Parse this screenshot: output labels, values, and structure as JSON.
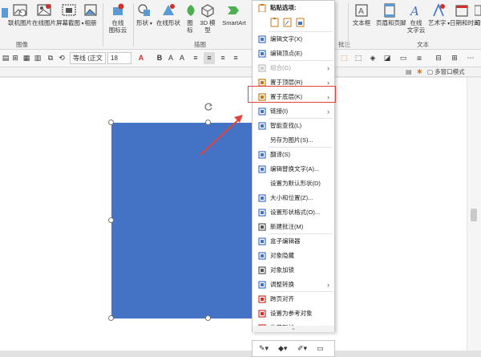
{
  "ribbon": {
    "buttons": [
      {
        "label": "联机图片",
        "icon": "online-picture-icon"
      },
      {
        "label": "在线图片",
        "icon": "picture-icon"
      },
      {
        "label": "屏幕截图",
        "icon": "screenshot-icon"
      },
      {
        "label": "相册",
        "icon": "album-icon"
      },
      {
        "label": "在线",
        "label2": "图标云",
        "icon": "icon-cloud-icon"
      },
      {
        "label": "形状",
        "icon": "shapes-icon"
      },
      {
        "label": "在线形状",
        "icon": "online-shapes-icon"
      },
      {
        "label": "图",
        "label2": "标",
        "icon": "icons-icon"
      },
      {
        "label": "3D 模",
        "label2": "型",
        "icon": "3d-model-icon"
      },
      {
        "label": "SmartArt",
        "icon": "smartart-icon"
      },
      {
        "label": "文本框",
        "icon": "textbox-icon"
      },
      {
        "label": "页眉和页脚",
        "icon": "header-footer-icon"
      },
      {
        "label": "艺术字",
        "icon": "wordart-icon"
      },
      {
        "label": "在线",
        "label2": "文字云",
        "icon": "word-cloud-icon"
      },
      {
        "label": "日期和时间",
        "icon": "date-time-icon"
      },
      {
        "label": "幻",
        "icon": "slide-icon"
      }
    ],
    "groups": {
      "images": "图像",
      "illustrations": "插图",
      "comments": "批注",
      "text": "文本"
    }
  },
  "format_toolbar": {
    "font_name": "等线 (正文",
    "font_size": "18"
  },
  "multi_window": "多窗口模式",
  "context_menu": {
    "paste_options": "粘贴选项:",
    "items": [
      {
        "label": "编辑文字(X)",
        "icon": "edit-text-icon",
        "arrow": false,
        "disabled": false
      },
      {
        "label": "编辑顶点(E)",
        "icon": "edit-points-icon",
        "arrow": false,
        "disabled": false
      },
      {
        "label": "组合(G)",
        "icon": "group-icon",
        "arrow": true,
        "disabled": true
      },
      {
        "label": "置于顶层(R)",
        "icon": "bring-to-front-icon",
        "arrow": true,
        "disabled": false
      },
      {
        "label": "置于底层(K)",
        "icon": "send-to-back-icon",
        "arrow": true,
        "disabled": false
      },
      {
        "label": "链接(I)",
        "icon": "link-icon",
        "arrow": true,
        "disabled": false
      },
      {
        "label": "智能查找(L)",
        "icon": "smart-lookup-icon",
        "arrow": false,
        "disabled": false
      },
      {
        "label": "另存为图片(S)...",
        "icon": "",
        "arrow": false,
        "disabled": false
      },
      {
        "label": "翻译(S)",
        "icon": "translate-icon",
        "arrow": false,
        "disabled": false
      },
      {
        "label": "编辑替换文字(A)...",
        "icon": "alt-text-icon",
        "arrow": false,
        "disabled": false
      },
      {
        "label": "设置为默认形状(D)",
        "icon": "",
        "arrow": false,
        "disabled": false
      },
      {
        "label": "大小和位置(Z)...",
        "icon": "size-position-icon",
        "arrow": false,
        "disabled": false
      },
      {
        "label": "设置形状格式(O)...",
        "icon": "format-shape-icon",
        "arrow": false,
        "disabled": false
      },
      {
        "label": "新建批注(M)",
        "icon": "new-comment-icon",
        "arrow": false,
        "disabled": false
      },
      {
        "label": "盒子编辑器",
        "icon": "box-editor-icon",
        "arrow": false,
        "disabled": false
      },
      {
        "label": "对象隐藏",
        "icon": "hide-object-icon",
        "arrow": false,
        "disabled": false
      },
      {
        "label": "对象加锁",
        "icon": "lock-object-icon",
        "arrow": false,
        "disabled": false
      },
      {
        "label": "调整转换",
        "icon": "adjust-convert-icon",
        "arrow": true,
        "disabled": false
      },
      {
        "label": "跨页对齐",
        "icon": "cross-page-align-icon",
        "arrow": false,
        "disabled": false
      },
      {
        "label": "设置为参考对象",
        "icon": "reference-object-icon",
        "arrow": false,
        "disabled": false
      },
      {
        "label": "收藏形状",
        "icon": "favorite-shape-icon",
        "arrow": false,
        "disabled": false
      }
    ]
  },
  "colors": {
    "shape_fill": "#4472c4",
    "highlight": "#e0443a",
    "accent_red": "#d0302a"
  }
}
